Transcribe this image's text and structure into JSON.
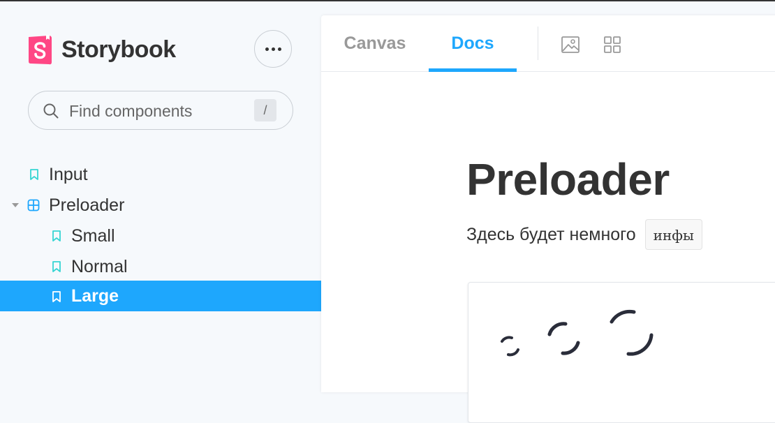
{
  "sidebar": {
    "brand": "Storybook",
    "search": {
      "placeholder": "Find components",
      "value": "",
      "shortcut": "/"
    },
    "tree": [
      {
        "label": "Input",
        "type": "story",
        "level": 0,
        "selected": false
      },
      {
        "label": "Preloader",
        "type": "component",
        "level": 0,
        "expanded": true,
        "selected": false
      },
      {
        "label": "Small",
        "type": "story",
        "level": 1,
        "selected": false
      },
      {
        "label": "Normal",
        "type": "story",
        "level": 1,
        "selected": false
      },
      {
        "label": "Large",
        "type": "story",
        "level": 1,
        "selected": true
      }
    ]
  },
  "toolbar": {
    "tabs": [
      {
        "label": "Canvas",
        "active": false
      },
      {
        "label": "Docs",
        "active": true
      }
    ],
    "icons": [
      "image-icon",
      "grid-icon"
    ]
  },
  "doc": {
    "title": "Preloader",
    "description": "Здесь будет немного",
    "code": "инфы"
  },
  "preview": {
    "spinners": [
      "small",
      "normal",
      "large"
    ]
  },
  "colors": {
    "accent": "#1ea7fd",
    "brand_pink": "#ff4785",
    "story_icon": "#37d5d3",
    "component_icon": "#1ea7fd",
    "text": "#333333",
    "sidebar_bg": "#f6f9fc"
  }
}
